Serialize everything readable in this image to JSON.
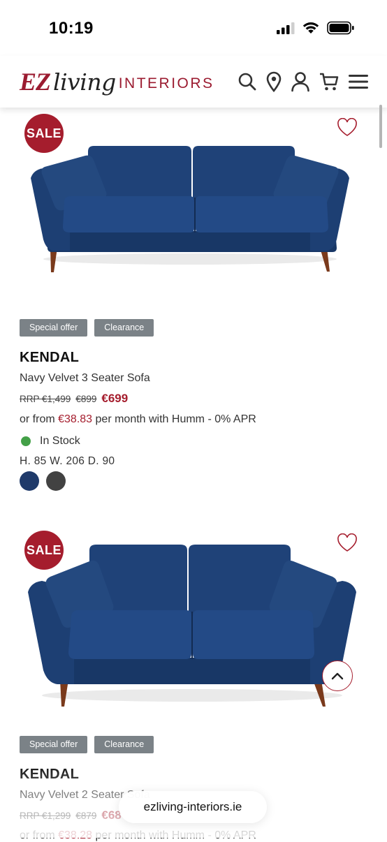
{
  "status_bar": {
    "time": "10:19",
    "icons": [
      "signal-icon",
      "wifi-icon",
      "battery-icon"
    ]
  },
  "header": {
    "logo_ez": "EZ",
    "logo_living": "living",
    "logo_interiors": "INTERIORS",
    "icons": [
      "search-icon",
      "location-icon",
      "account-icon",
      "cart-icon",
      "menu-icon"
    ]
  },
  "products": [
    {
      "badge": "SALE",
      "tags": [
        "Special offer",
        "Clearance"
      ],
      "name": "KENDAL",
      "description": "Navy Velvet 3 Seater Sofa",
      "rrp": "RRP €1,499",
      "was_price": "€899",
      "price": "€699",
      "finance_prefix": "or from",
      "finance_amount": "€38.83",
      "finance_suffix": "per month with Humm - 0% APR",
      "stock": "In Stock",
      "dimensions": "H. 85 W. 206 D. 90",
      "swatches": [
        "#1f3a6a",
        "#424242"
      ]
    },
    {
      "badge": "SALE",
      "tags": [
        "Special offer",
        "Clearance"
      ],
      "name": "KENDAL",
      "description": "Navy Velvet 2 Seater Sofa",
      "rrp": "RRP €1,299",
      "was_price": "€879",
      "price": "€68",
      "finance_prefix": "or from",
      "finance_amount": "€38.28",
      "finance_suffix": "per month with Humm - 0% APR"
    }
  ],
  "browser": {
    "url": "ezliving-interiors.ie"
  },
  "colors": {
    "brand": "#9b1b30",
    "sale": "#a51d2d",
    "tag": "#7b8287",
    "in_stock": "#43a047",
    "sofa_navy": "#1d3f73"
  }
}
